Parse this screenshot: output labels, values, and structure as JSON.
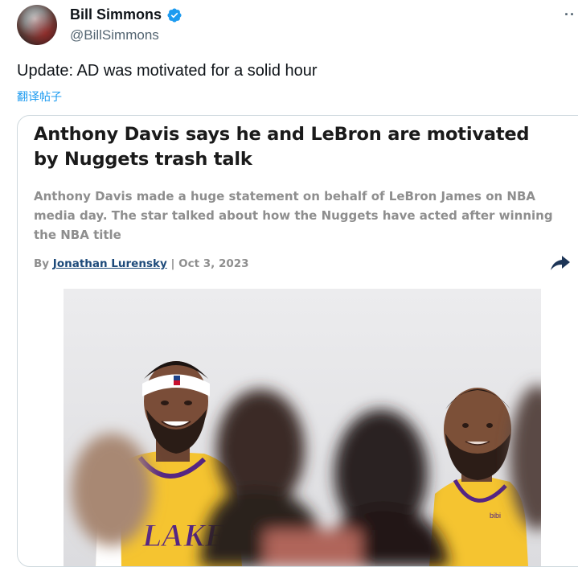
{
  "author": {
    "display_name": "Bill Simmons",
    "handle": "@BillSimmons",
    "verified_icon": "verified-badge-icon"
  },
  "more_icon": "more-options-icon",
  "tweet": {
    "text": "Update: AD was motivated for a solid hour",
    "translate_label": "翻译帖子"
  },
  "card": {
    "headline": "Anthony Davis says he and LeBron are motivated by Nuggets trash talk",
    "summary": "Anthony Davis made a huge statement on behalf of LeBron James on NBA media day. The star talked about how the Nuggets have acted after winning the NBA title",
    "byline_prefix": "By",
    "byline_author": "Jonathan Lurensky",
    "byline_date": " | Oct 3, 2023",
    "share_icon": "share-arrow-icon",
    "photo_logo_text": "LAKE",
    "photo_sponsor_text": "bibi"
  },
  "colors": {
    "link_blue": "#1d9bf0",
    "lakers_gold": "#f5c430",
    "lakers_purple": "#552583",
    "author_link": "#1d4a7a"
  }
}
